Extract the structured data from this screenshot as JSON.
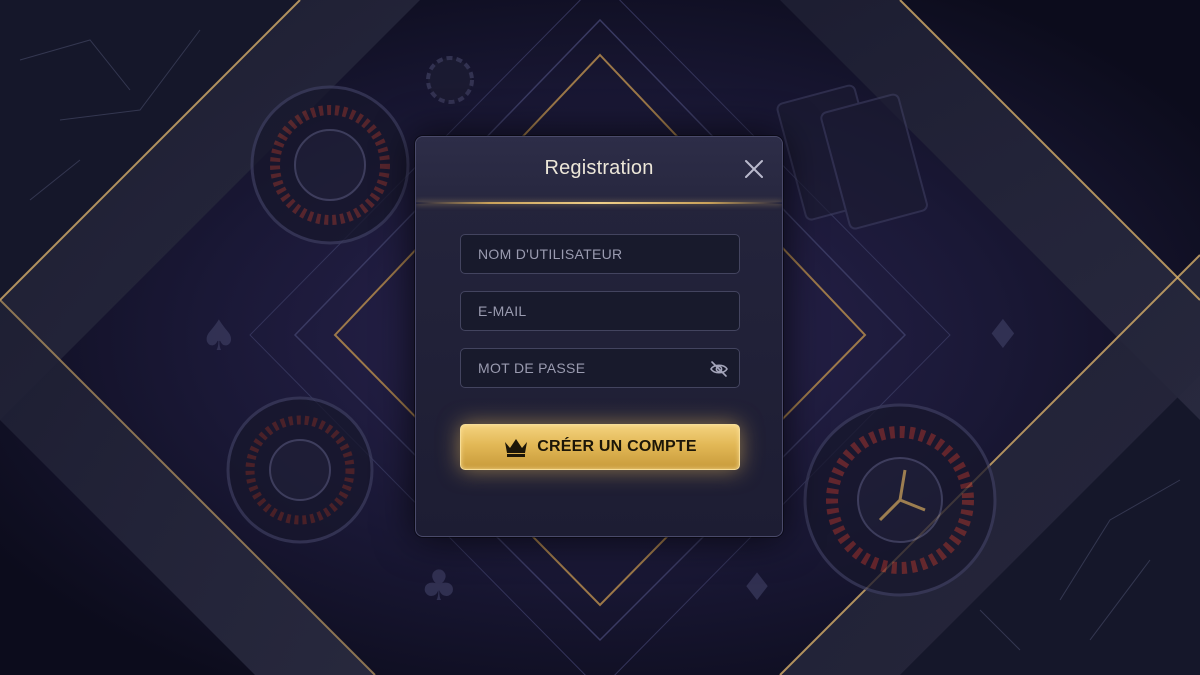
{
  "modal": {
    "title": "Registration",
    "close_icon": "close-icon"
  },
  "form": {
    "username_placeholder": "NOM D'UTILISATEUR",
    "email_placeholder": "E-MAIL",
    "password_placeholder": "MOT DE PASSE",
    "password_toggle_icon": "eye-off-icon",
    "submit_label": "CRÉER UN COMPTE",
    "submit_icon": "crown-icon"
  },
  "colors": {
    "accent_gold": "#e2b856",
    "background": "#0f1022",
    "panel": "#1d1d33"
  }
}
